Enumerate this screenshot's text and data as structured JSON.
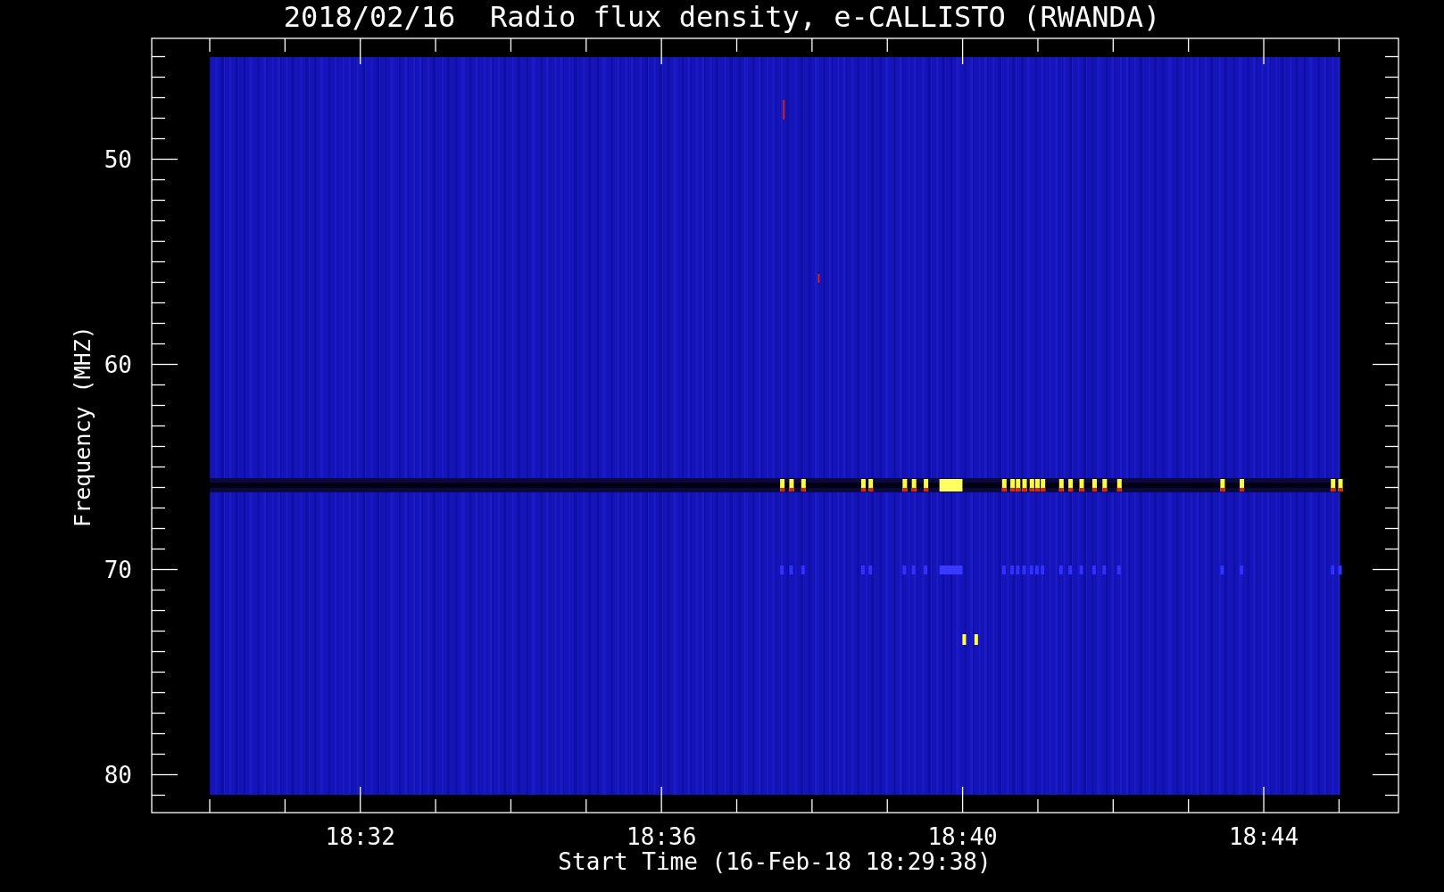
{
  "title": "2018/02/16  Radio flux density, e-CALLISTO (RWANDA)",
  "x_axis": {
    "label": "Start Time (16-Feb-18 18:29:38)",
    "ticks": [
      "18:32",
      "18:36",
      "18:40",
      "18:44"
    ]
  },
  "y_axis": {
    "label": "Frequency (MHZ)",
    "ticks": [
      "50",
      "60",
      "70",
      "80"
    ]
  }
}
